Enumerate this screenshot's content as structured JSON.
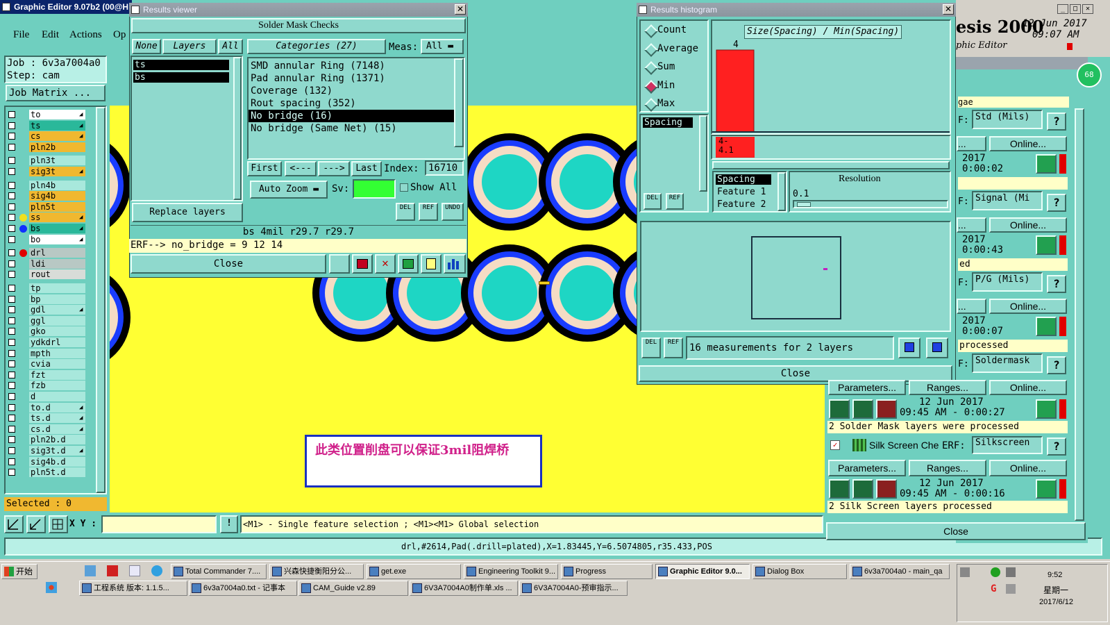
{
  "main": {
    "title": "Graphic Editor 9.07b2 (00@H",
    "menu": [
      "File",
      "Edit",
      "Actions",
      "Op"
    ],
    "job": "Job : 6v3a7004a0",
    "step": "Step: cam",
    "job_matrix": "Job Matrix ...",
    "layers": [
      {
        "name": "to",
        "color": "#ffffff",
        "ind": "◢"
      },
      {
        "name": "ts",
        "color": "#2ab89a",
        "ind": "◢"
      },
      {
        "name": "cs",
        "color": "#f0b830",
        "ind": "◢"
      },
      {
        "name": "pln2b",
        "color": "#f0b830",
        "ind": ""
      },
      {
        "name": "pln3t",
        "color": "#a8e8dc",
        "ind": ""
      },
      {
        "name": "sig3t",
        "color": "#f0b830",
        "ind": "◢"
      },
      {
        "name": "pln4b",
        "color": "#a8e8dc",
        "ind": ""
      },
      {
        "name": "sig4b",
        "color": "#f0b830",
        "ind": ""
      },
      {
        "name": "pln5t",
        "color": "#f0b830",
        "ind": ""
      },
      {
        "name": "ss",
        "color": "#f0b830",
        "ind": "◢"
      },
      {
        "name": "bs",
        "color": "#2ab89a",
        "ind": "◢"
      },
      {
        "name": "bo",
        "color": "#ffffff",
        "ind": "◢"
      },
      {
        "name": "drl",
        "color": "#b8c8c4",
        "ind": ""
      },
      {
        "name": "ldi",
        "color": "#b8c8c4",
        "ind": ""
      },
      {
        "name": "rout",
        "color": "#d8dcd8",
        "ind": ""
      },
      {
        "name": "tp",
        "color": "#a8e8dc",
        "ind": ""
      },
      {
        "name": "bp",
        "color": "#a8e8dc",
        "ind": ""
      },
      {
        "name": "gdl",
        "color": "#a8e8dc",
        "ind": "◢"
      },
      {
        "name": "ggl",
        "color": "#a8e8dc",
        "ind": ""
      },
      {
        "name": "gko",
        "color": "#a8e8dc",
        "ind": ""
      },
      {
        "name": "ydkdrl",
        "color": "#a8e8dc",
        "ind": ""
      },
      {
        "name": "mpth",
        "color": "#a8e8dc",
        "ind": ""
      },
      {
        "name": "cvia",
        "color": "#a8e8dc",
        "ind": ""
      },
      {
        "name": "fzt",
        "color": "#a8e8dc",
        "ind": ""
      },
      {
        "name": "fzb",
        "color": "#a8e8dc",
        "ind": ""
      },
      {
        "name": "d",
        "color": "#a8e8dc",
        "ind": ""
      },
      {
        "name": "to.d",
        "color": "#a8e8dc",
        "ind": "◢"
      },
      {
        "name": "ts.d",
        "color": "#a8e8dc",
        "ind": "◢"
      },
      {
        "name": "cs.d",
        "color": "#a8e8dc",
        "ind": "◢"
      },
      {
        "name": "pln2b.d",
        "color": "#a8e8dc",
        "ind": ""
      },
      {
        "name": "sig3t.d",
        "color": "#a8e8dc",
        "ind": "◢"
      },
      {
        "name": "sig4b.d",
        "color": "#a8e8dc",
        "ind": ""
      },
      {
        "name": "pln5t.d",
        "color": "#a8e8dc",
        "ind": ""
      }
    ],
    "selected": "Selected : 0",
    "xy_label": "X Y :",
    "xy_value": "",
    "hint": "<M1> - Single feature selection ; <M1><M1> Global selection",
    "status": "drl,#2614,Pad(.drill=plated),X=1.83445,Y=6.5074805,r35.433,POS",
    "annotation": "此类位置削盘可以保证3mil阻焊桥"
  },
  "results_viewer": {
    "title": "Results viewer",
    "header": "Solder Mask Checks",
    "none_btn": "None",
    "layers_btn": "Layers",
    "all_btn": "All",
    "layer_items": [
      "ts",
      "bs"
    ],
    "categories_btn": "Categories (27)",
    "meas_label": "Meas:",
    "meas_value": "All",
    "categories": [
      "SMD annular Ring (7148)",
      "Pad annular Ring (1371)",
      "Coverage (132)",
      "Rout spacing (352)",
      "No bridge (16)",
      "No bridge (Same Net) (15)"
    ],
    "selected_category": 4,
    "first": "First",
    "prev": "<---",
    "next": "--->",
    "last": "Last",
    "index_label": "Index:",
    "index_value": "16710",
    "auto_zoom": "Auto Zoom",
    "sv_label": "Sv:",
    "show_all": "Show All",
    "replace_layers": "Replace layers",
    "del": "DEL",
    "ref": "REF",
    "undo": "UNDO",
    "info": "bs 4mil  r29.7  r29.7",
    "erf": "ERF--> no_bridge = 9 12 14",
    "close": "Close"
  },
  "histogram": {
    "title": "Results histogram",
    "modes": [
      "Count",
      "Average",
      "Sum",
      "Min",
      "Max"
    ],
    "selected_mode": "Min",
    "list_item": "Spacing",
    "plot_title": "Size(Spacing) / Min(Spacing)",
    "bar_count": "4",
    "bar_range": "4-\n4.1",
    "legend": [
      "Spacing",
      "Feature 1",
      "Feature 2"
    ],
    "resolution_label": "Resolution",
    "resolution_value": "0.1",
    "measurements": "16 measurements for 2 layers",
    "close": "Close"
  },
  "chart_data": {
    "type": "bar",
    "title": "Size(Spacing) / Min(Spacing)",
    "categories": [
      "4-4.1"
    ],
    "values": [
      4
    ]
  },
  "qa": {
    "title_part": "esis 2000",
    "subtitle": "phic Editor",
    "date": "12 Jun 2017",
    "time": "09:07 AM",
    "badge": "68",
    "top_label": "gae",
    "rows": [
      {
        "erf": "Std (Mils)",
        "online": "Online...",
        "year": "2017",
        "elapsed": "0:00:02",
        "msg": ""
      },
      {
        "erf": "Signal (Mi",
        "online": "Online...",
        "year": "2017",
        "elapsed": "0:00:43",
        "msg": "ed"
      },
      {
        "erf": "P/G (Mils)",
        "online": "Online...",
        "year": "2017",
        "elapsed": "0:00:07",
        "msg": "processed"
      },
      {
        "erf": "Soldermask",
        "online": "Online...",
        "year": "12 Jun 2017",
        "elapsed": "09:45 AM - 0:00:27",
        "msg": "2 Solder Mask layers were processed"
      }
    ],
    "params": "Parameters...",
    "ranges": "Ranges...",
    "silk_name": "Silk Screen Che",
    "silk_erf_label": "ERF:",
    "silk_erf": "Silkscreen",
    "silk_online": "Online...",
    "silk_date": "12 Jun 2017",
    "silk_time": "09:45 AM - 0:00:16",
    "silk_msg": "2 Silk Screen layers processed",
    "close": "Close"
  },
  "taskbar": {
    "start": "开始",
    "row1": [
      "Total Commander 7....",
      "兴森快捷衡阳分公...",
      "get.exe",
      "Engineering Toolkit 9...",
      "Progress",
      "Graphic Editor 9.0...",
      "Dialog Box",
      "6v3a7004a0 - main_qa"
    ],
    "row2": [
      "工程系统  版本: 1.1.5...",
      "6v3a7004a0.txt - 记事本",
      "CAM_Guide v2.89",
      "6V3A7004A0制作单.xls ...",
      "6V3A7004A0-预审指示..."
    ],
    "active": "Graphic Editor 9.0...",
    "clock": "9:52",
    "weekday": "星期一",
    "date": "2017/6/12"
  }
}
